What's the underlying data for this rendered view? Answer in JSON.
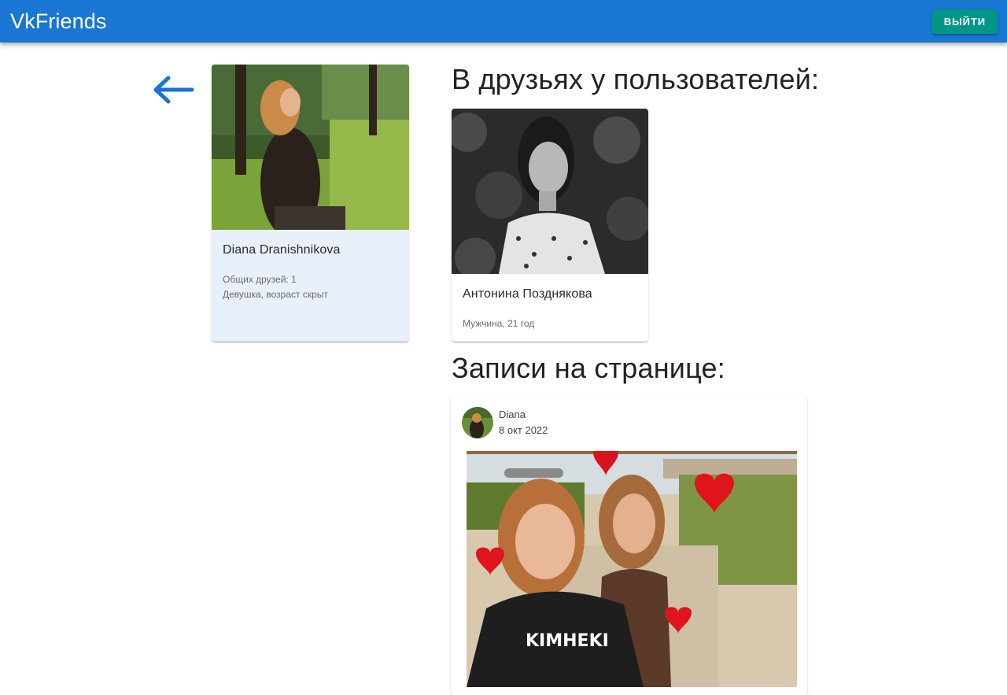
{
  "app": {
    "brand": "VkFriends",
    "logout_label": "Выйти",
    "accent_color": "#1976d2",
    "logout_color": "#009688"
  },
  "nav": {
    "back_icon": "arrow-left-icon"
  },
  "profile": {
    "name": "Diana Dranishnikova",
    "mutual_friends": "Общих друзей: 1",
    "info": "Девушка, возраст скрыт"
  },
  "friends_section": {
    "title": "В друзьях у пользователей:",
    "items": [
      {
        "name": "Антонина Позднякова",
        "info": "Мужчина, 21 год"
      }
    ]
  },
  "posts_section": {
    "title": "Записи на странице:",
    "items": [
      {
        "author": "Diana",
        "date": "8 окт 2022"
      }
    ]
  }
}
